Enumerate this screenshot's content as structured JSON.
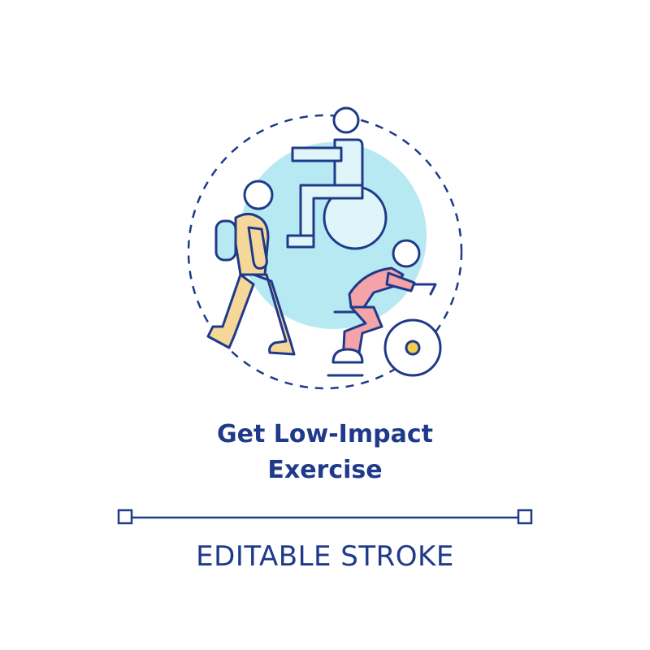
{
  "caption": {
    "line1": "Get Low-Impact",
    "line2": "Exercise"
  },
  "footer": {
    "label": "EDITABLE STROKE"
  },
  "colors": {
    "outline": "#1f3a8a",
    "circle_fill": "#b7e9f2",
    "walker_fill": "#f6d79a",
    "cyclist_fill": "#f4a3a8",
    "wheelchair_fill": "#dff5f9",
    "wheel_hub": "#f3d04a"
  },
  "icons": [
    "walker-icon",
    "wheelchair-user-icon",
    "cyclist-icon",
    "dashed-ring-icon",
    "editable-stroke-line-icon"
  ]
}
